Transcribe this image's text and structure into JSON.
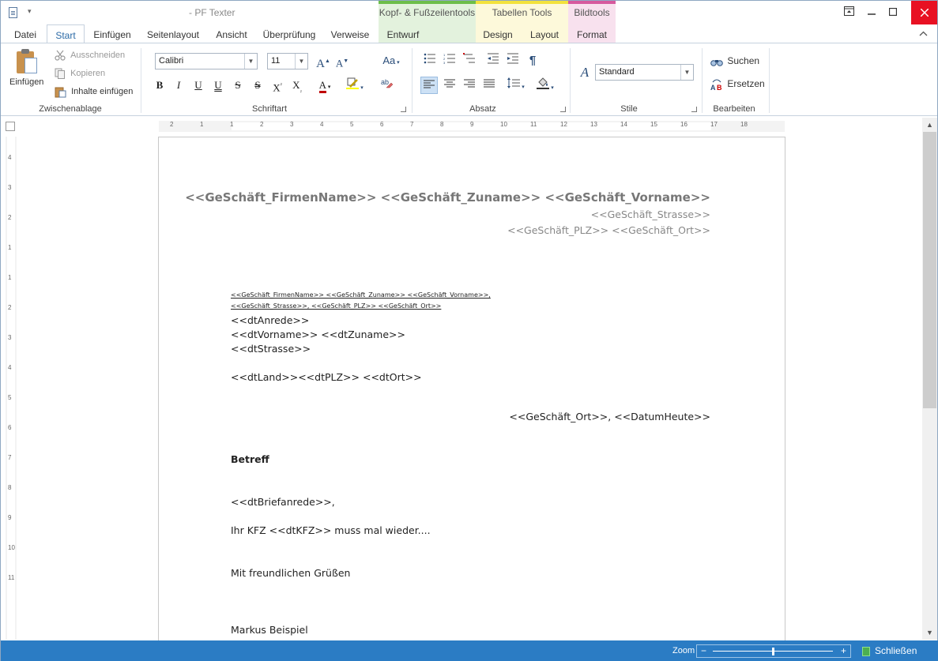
{
  "app": {
    "title": "- PF Texter"
  },
  "context_groups": {
    "kopf": "Kopf- & Fußzeilentools",
    "tabellen": "Tabellen Tools",
    "bild": "Bildtools"
  },
  "tabs": {
    "datei": "Datei",
    "start": "Start",
    "einfuegen": "Einfügen",
    "seitenlayout": "Seitenlayout",
    "ansicht": "Ansicht",
    "ueberpruefung": "Überprüfung",
    "verweise": "Verweise",
    "entwurf": "Entwurf",
    "design": "Design",
    "layout": "Layout",
    "format": "Format"
  },
  "clipboard": {
    "paste": "Einfügen",
    "cut": "Ausschneiden",
    "copy": "Kopieren",
    "paste_content": "Inhalte einfügen",
    "label": "Zwischenablage"
  },
  "font": {
    "family": "Calibri",
    "size": "11",
    "bold": "B",
    "italic": "I",
    "underline": "U",
    "double_underline": "U",
    "strike": "S",
    "double_strike": "S",
    "superscript": "X",
    "subscript": "X",
    "color": "A",
    "label": "Schriftart"
  },
  "paragraph": {
    "label": "Absatz"
  },
  "styles": {
    "current": "Standard",
    "label": "Stile"
  },
  "editing": {
    "find": "Suchen",
    "replace": "Ersetzen",
    "label": "Bearbeiten"
  },
  "ruler": {
    "h_labels": [
      "2",
      "1",
      "1",
      "2",
      "3",
      "4",
      "5",
      "6",
      "7",
      "8",
      "9",
      "10",
      "11",
      "12",
      "13",
      "14",
      "15",
      "16",
      "17",
      "18"
    ],
    "v_labels": [
      "4",
      "3",
      "2",
      "1",
      "1",
      "2",
      "3",
      "4",
      "5",
      "6",
      "7",
      "8",
      "9",
      "10",
      "11"
    ]
  },
  "document": {
    "sender_name": "<<GeSchäft_FirmenName>> <<GeSchäft_Zuname>> <<GeSchäft_Vorname>>",
    "sender_street": "<<GeSchäft_Strasse>>",
    "sender_city": "<<GeSchäft_PLZ>> <<GeSchäft_Ort>>",
    "return_line_1": "<<GeSchäft_FirmenName>> <<GeSchäft_Zuname>> <<GeSchäft_Vorname>>,",
    "return_line_2": "<<GeSchäft_Strasse>>, <<GeSchäft_PLZ>> <<GeSchäft_Ort>>",
    "recipient_salutation": "<<dtAnrede>>",
    "recipient_name": "<<dtVorname>> <<dtZuname>>",
    "recipient_street": "<<dtStrasse>>",
    "recipient_city": "<<dtLand>><<dtPLZ>> <<dtOrt>>",
    "date_line": "<<GeSchäft_Ort>>, <<DatumHeute>>",
    "subject": "Betreff",
    "greeting": "<<dtBriefanrede>>,",
    "body": "Ihr KFZ <<dtKFZ>> muss mal wieder....",
    "closing": "Mit freundlichen Grüßen",
    "signature": "Markus Beispiel"
  },
  "status": {
    "zoom_label": "Zoom",
    "zoom_level": 0.5,
    "close": "Schließen"
  }
}
